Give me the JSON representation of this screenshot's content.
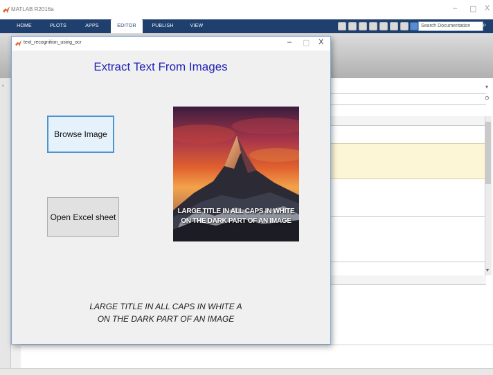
{
  "app": {
    "title": "MATLAB R2016a",
    "window_controls": [
      "–",
      "▢",
      "X"
    ],
    "ribbon_tabs": [
      {
        "label": "HOME",
        "active": false
      },
      {
        "label": "PLOTS",
        "active": false
      },
      {
        "label": "APPS",
        "active": false
      },
      {
        "label": "EDITOR",
        "active": true
      },
      {
        "label": "PUBLISH",
        "active": false
      },
      {
        "label": "VIEW",
        "active": false
      }
    ],
    "search_placeholder": "Search Documentation",
    "ribbon_color": "#1f3f6e"
  },
  "figure": {
    "title": "text_recognition_using_ocr",
    "window_controls": [
      "–",
      "▢",
      "X"
    ],
    "heading": "Extract Text From Images",
    "heading_color": "#2424b8",
    "browse_button": "Browse Image",
    "excel_button": "Open Excel sheet",
    "image_caption_line1": "LARGE TITLE IN ALL CAPS IN WHITE",
    "image_caption_line2": "ON THE DARK PART OF AN IMAGE",
    "result_line1": "LARGE TITLE IN ALL CAPS IN WHITE A",
    "result_line2": "ON THE DARK PART OF AN IMAGE"
  }
}
